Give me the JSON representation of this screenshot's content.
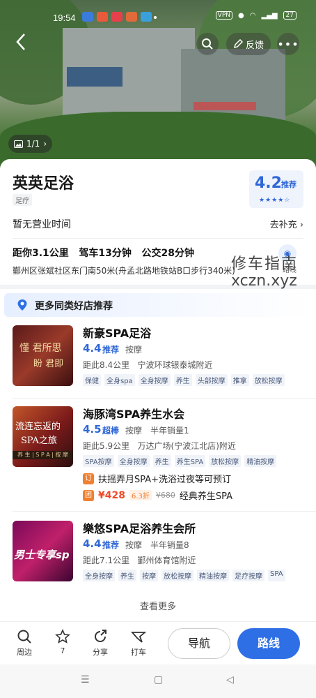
{
  "status_bar": {
    "time": "19:54",
    "vpn": "VPN",
    "battery": "27"
  },
  "header": {
    "feedback_label": "反馈",
    "photo_count": "1/1"
  },
  "place": {
    "name": "英英足浴",
    "category": "足疗",
    "rating": "4.2",
    "rating_label": "推荐",
    "hours": "暂无营业时间",
    "hours_action": "去补充",
    "distance_summary": "距你3.1公里   驾车13分钟   公交28分钟",
    "address": "鄞州区张斌社区东门南50米(舟孟北路地铁站B口步行340米)",
    "route_label": "路线"
  },
  "watermark": {
    "line1": "修车指南",
    "line2": "xczn.xyz"
  },
  "recommend": {
    "header": "更多同类好店推荐",
    "shops": [
      {
        "name": "新豪SPA足浴",
        "score": "4.4",
        "badge": "推荐",
        "category": "按摩",
        "sales": "",
        "location": "距此8.4公里   宁波环球银泰城附近",
        "tags": [
          "保健",
          "全身spa",
          "全身按摩",
          "养生",
          "头部按摩",
          "推拿",
          "放松按摩"
        ]
      },
      {
        "name": "海豚湾SPA养生水会",
        "score": "4.5",
        "badge": "超棒",
        "category": "按摩",
        "sales": "半年销量1",
        "location": "距此5.9公里   万达广场(宁波江北店)附近",
        "tags": [
          "SPA按摩",
          "全身按摩",
          "养生",
          "养生SPA",
          "放松按摩",
          "精油按摩"
        ],
        "deal_booking": {
          "icon": "订",
          "text": "扶摇弄月SPA+洗浴过夜等可预订"
        },
        "deal_group": {
          "icon": "团",
          "price": "¥428",
          "discount": "6.3折",
          "original": "¥680",
          "text": "经典养生SPA"
        }
      },
      {
        "name": "樂悠SPA足浴养生会所",
        "score": "4.4",
        "badge": "推荐",
        "category": "按摩",
        "sales": "半年销量8",
        "location": "距此7.1公里   鄞州体育馆附近",
        "tags": [
          "全身按摩",
          "养生",
          "按摩",
          "放松按摩",
          "精油按摩",
          "足疗按摩",
          "SPA"
        ]
      }
    ],
    "see_more": "查看更多"
  },
  "bottom_bar": {
    "nearby": "周边",
    "favorites": "7",
    "share": "分享",
    "taxi": "打车",
    "navigate": "导航",
    "route": "路线"
  }
}
